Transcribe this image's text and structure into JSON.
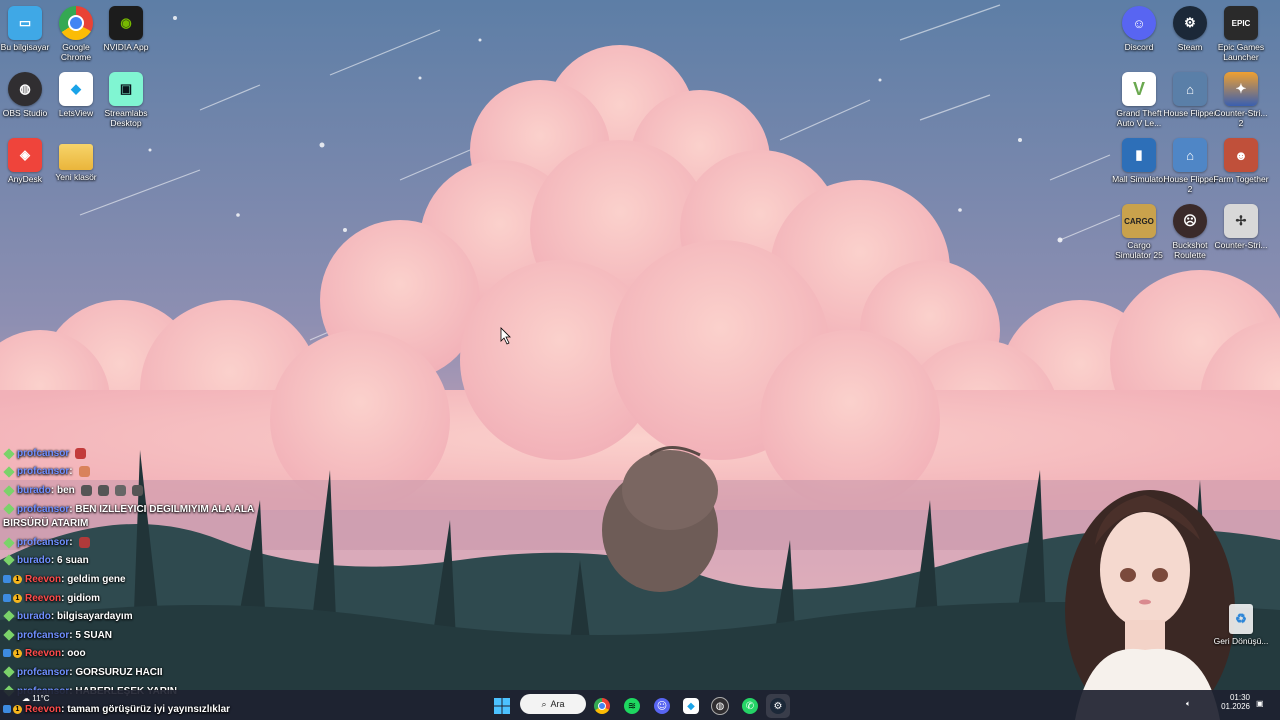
{
  "desktop": {
    "left_icons": [
      {
        "label": "Bu bilgisayar",
        "icon": "monitor-icon",
        "color": "#3fa8e6"
      },
      {
        "label": "Google Chrome",
        "icon": "chrome-icon",
        "color": "#e94235"
      },
      {
        "label": "NVIDIA App",
        "icon": "nvidia-icon",
        "color": "#76b900"
      },
      {
        "label": "OBS Studio",
        "icon": "obs-icon",
        "color": "#302e31"
      },
      {
        "label": "LetsView",
        "icon": "letsview-icon",
        "color": "#1aa3e8"
      },
      {
        "label": "Streamlabs Desktop",
        "icon": "streamlabs-icon",
        "color": "#80f5d2"
      },
      {
        "label": "AnyDesk",
        "icon": "anydesk-icon",
        "color": "#ef443b"
      },
      {
        "label": "Yeni klasör",
        "icon": "folder-icon",
        "color": "#f4c44e"
      }
    ],
    "right_icons": [
      {
        "label": "Discord",
        "icon": "discord-icon",
        "color": "#5865f2"
      },
      {
        "label": "Steam",
        "icon": "steam-icon",
        "color": "#1b2838"
      },
      {
        "label": "Epic Games Launcher",
        "icon": "epic-icon",
        "color": "#2a2a2a"
      },
      {
        "label": "Grand Theft Auto V Le...",
        "icon": "gta-icon",
        "color": "#6aa84f"
      },
      {
        "label": "House Flipper",
        "icon": "house-flipper-icon",
        "color": "#5a7fa8"
      },
      {
        "label": "Counter-Stri... 2",
        "icon": "cs2-icon",
        "color": "#f0a030"
      },
      {
        "label": "Mall Simulator",
        "icon": "mall-simulator-icon",
        "color": "#2d6fb8"
      },
      {
        "label": "House Flipper 2",
        "icon": "house-flipper-2-icon",
        "color": "#4f86c6"
      },
      {
        "label": "Farm Together",
        "icon": "farm-together-icon",
        "color": "#c0503a"
      },
      {
        "label": "Cargo Simulator 25",
        "icon": "cargo-simulator-icon",
        "color": "#c9a24c"
      },
      {
        "label": "Buckshot Roulette",
        "icon": "buckshot-roulette-icon",
        "color": "#3a2a2a"
      },
      {
        "label": "Counter-Stri...",
        "icon": "counter-strike-icon",
        "color": "#d8d8d8"
      }
    ],
    "recycle_bin": {
      "label": "Geri Dönüşü...",
      "icon": "recycle-bin-icon"
    }
  },
  "chat": {
    "messages": [
      {
        "user": "profcansor",
        "text": "",
        "user_color": "blue",
        "badges": [
          "green"
        ]
      },
      {
        "user": "profcansor",
        "text": ":",
        "user_color": "blue",
        "badges": [
          "green"
        ]
      },
      {
        "user": "burado",
        "text": ": ben",
        "user_color": "blue",
        "badges": [
          "green"
        ]
      },
      {
        "user": "profcansor",
        "text": ": BEN IZLLEYICI DEGILMIYIM ALA ALA",
        "user_color": "blue",
        "badges": [
          "green"
        ]
      },
      {
        "user": "",
        "text": "BIRSÜRÜ ATARIM",
        "user_color": "",
        "badges": []
      },
      {
        "user": "profcansor",
        "text": ":",
        "user_color": "blue",
        "badges": [
          "green"
        ]
      },
      {
        "user": "burado",
        "text": ": 6 suan",
        "user_color": "blue",
        "badges": [
          "green"
        ]
      },
      {
        "user": "Reevon",
        "text": ": geldim gene",
        "user_color": "red",
        "badges": [
          "blue",
          "gold"
        ]
      },
      {
        "user": "Reevon",
        "text": ": gidiom",
        "user_color": "red",
        "badges": [
          "blue",
          "gold"
        ]
      },
      {
        "user": "burado",
        "text": ": bilgisayardayım",
        "user_color": "blue",
        "badges": [
          "green"
        ]
      },
      {
        "user": "profcansor",
        "text": ": 5 SUAN",
        "user_color": "blue",
        "badges": [
          "green"
        ]
      },
      {
        "user": "Reevon",
        "text": ": ooo",
        "user_color": "red",
        "badges": [
          "blue",
          "gold"
        ]
      },
      {
        "user": "profcansor",
        "text": ": GORSURUZ HACII",
        "user_color": "blue",
        "badges": [
          "green"
        ]
      },
      {
        "user": "profcansor",
        "text": ": HABERLEŞEK YARIN",
        "user_color": "blue",
        "badges": [
          "green"
        ]
      },
      {
        "user": "Reevon",
        "text": ": tamam görüşürüz iyi yayınsızlıklar",
        "user_color": "red",
        "badges": [
          "blue",
          "gold"
        ]
      }
    ]
  },
  "taskbar": {
    "search_label": "Ara",
    "apps": [
      {
        "name": "start-button",
        "icon": "windows-icon"
      },
      {
        "name": "search",
        "icon": "search-icon"
      },
      {
        "name": "chrome-taskbar",
        "icon": "chrome-icon"
      },
      {
        "name": "spotify-taskbar",
        "icon": "spotify-icon"
      },
      {
        "name": "discord-taskbar",
        "icon": "discord-icon"
      },
      {
        "name": "letsview-taskbar",
        "icon": "letsview-icon"
      },
      {
        "name": "obs-taskbar",
        "icon": "obs-icon"
      },
      {
        "name": "whatsapp-taskbar",
        "icon": "whatsapp-icon"
      },
      {
        "name": "steam-taskbar",
        "icon": "steam-icon"
      }
    ],
    "weather": "11°C",
    "time": "01:30",
    "date": "01.2026"
  },
  "colors": {
    "sky_top": "#5f7fa8",
    "sky_bottom": "#d9a9b8",
    "cloud": "#f7c5c2",
    "grass": "#2b4046",
    "taskbar": "#1e2230"
  }
}
